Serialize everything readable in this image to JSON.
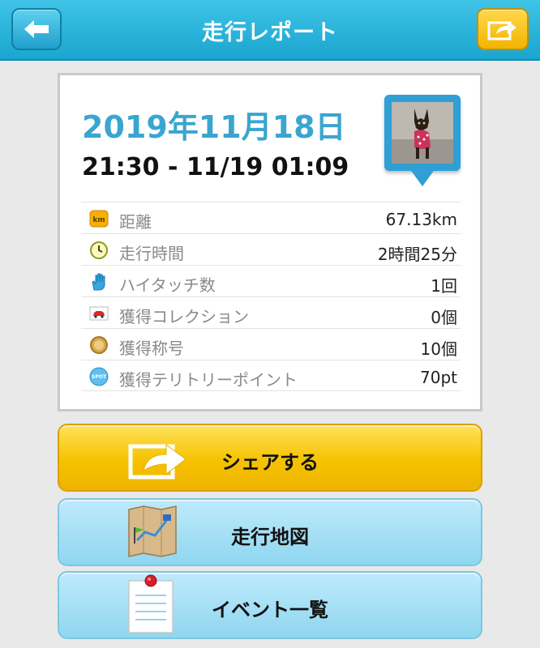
{
  "header": {
    "title": "走行レポート",
    "back_icon": "arrow-left-icon",
    "share_icon": "share-arrow-icon",
    "accent_color": "#1aa6cf",
    "share_color": "#f2b400"
  },
  "report": {
    "date": "2019年11月18日",
    "time_range": "21:30 - 11/19 01:09",
    "date_color": "#3aa6cf",
    "stats": [
      {
        "label": "距離",
        "value": "67.13km",
        "icon": "km-badge-icon"
      },
      {
        "label": "走行時間",
        "value": "2時間25分",
        "icon": "clock-icon"
      },
      {
        "label": "ハイタッチ数",
        "value": "1回",
        "icon": "hand-icon"
      },
      {
        "label": "獲得コレクション",
        "value": "0個",
        "icon": "car-card-icon"
      },
      {
        "label": "獲得称号",
        "value": "10個",
        "icon": "medal-icon"
      },
      {
        "label": "獲得テリトリーポイント",
        "value": "70pt",
        "icon": "spot-icon"
      }
    ]
  },
  "actions": {
    "share_label": "シェアする",
    "map_label": "走行地図",
    "event_label": "イベント一覧"
  }
}
